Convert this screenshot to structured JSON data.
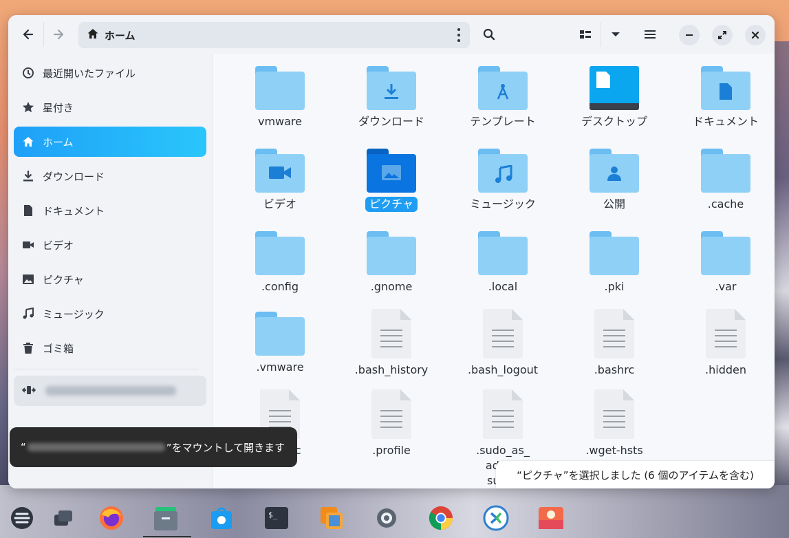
{
  "window": {
    "path": "ホーム",
    "icons": {
      "back": "back-arrow-icon",
      "forward": "forward-arrow-icon",
      "search": "search-icon",
      "view": "grid-view-icon",
      "dropdown": "chevron-down-icon",
      "menu": "hamburger-menu-icon",
      "minimize": "minimize-icon",
      "maximize": "maximize-icon",
      "close": "close-icon"
    }
  },
  "sidebar": {
    "items": [
      {
        "label": "最近開いたファイル",
        "icon": "clock-icon"
      },
      {
        "label": "星付き",
        "icon": "star-icon"
      },
      {
        "label": "ホーム",
        "icon": "home-icon"
      },
      {
        "label": "ダウンロード",
        "icon": "download-icon"
      },
      {
        "label": "ドキュメント",
        "icon": "document-icon"
      },
      {
        "label": "ビデオ",
        "icon": "video-icon"
      },
      {
        "label": "ピクチャ",
        "icon": "picture-icon"
      },
      {
        "label": "ミュージック",
        "icon": "music-icon"
      },
      {
        "label": "ゴミ箱",
        "icon": "trash-icon"
      }
    ],
    "active_index": 2,
    "account_icon": "network-drive-icon"
  },
  "files": [
    {
      "name": "vmware",
      "type": "folder"
    },
    {
      "name": "ダウンロード",
      "type": "folder"
    },
    {
      "name": "テンプレート",
      "type": "folder"
    },
    {
      "name": "デスクトップ",
      "type": "desktop"
    },
    {
      "name": "ドキュメント",
      "type": "folder"
    },
    {
      "name": "ビデオ",
      "type": "folder"
    },
    {
      "name": "ピクチャ",
      "type": "folder",
      "selected": true
    },
    {
      "name": "ミュージック",
      "type": "folder"
    },
    {
      "name": "公開",
      "type": "folder"
    },
    {
      "name": ".cache",
      "type": "folder"
    },
    {
      "name": ".config",
      "type": "folder"
    },
    {
      "name": ".gnome",
      "type": "folder"
    },
    {
      "name": ".local",
      "type": "folder"
    },
    {
      "name": ".pki",
      "type": "folder"
    },
    {
      "name": ".var",
      "type": "folder"
    },
    {
      "name": ".vmware",
      "type": "folder"
    },
    {
      "name": ".bash_history",
      "type": "file"
    },
    {
      "name": ".bash_logout",
      "type": "file"
    },
    {
      "name": ".bashrc",
      "type": "file"
    },
    {
      "name": ".hidden",
      "type": "file"
    },
    {
      "name": ".inputrc",
      "type": "file"
    },
    {
      "name": ".profile",
      "type": "file"
    },
    {
      "name": ".sudo_as_admin_successful",
      "type": "file",
      "display": [
        ".sudo_as_",
        "admin",
        "succe"
      ]
    },
    {
      "name": ".wget-hsts",
      "type": "file"
    }
  ],
  "toast": {
    "open_quote": "“",
    "suffix": "”をマウントして開きます"
  },
  "status": "“ピクチャ”を選択しました (6 個のアイテムを含む)",
  "dock": {
    "icons": [
      "zorin-menu-icon",
      "workspaces-icon",
      "firefox-icon",
      "files-icon",
      "software-store-icon",
      "terminal-icon",
      "virtualbox-icon",
      "settings-icon",
      "chrome-icon",
      "remote-desktop-icon",
      "image-viewer-icon"
    ]
  },
  "colors": {
    "accent": "#1e9df2",
    "folder_light": "#8fd0f7",
    "folder_tab": "#6cbdf2",
    "folder_selected": "#0a74e0"
  }
}
